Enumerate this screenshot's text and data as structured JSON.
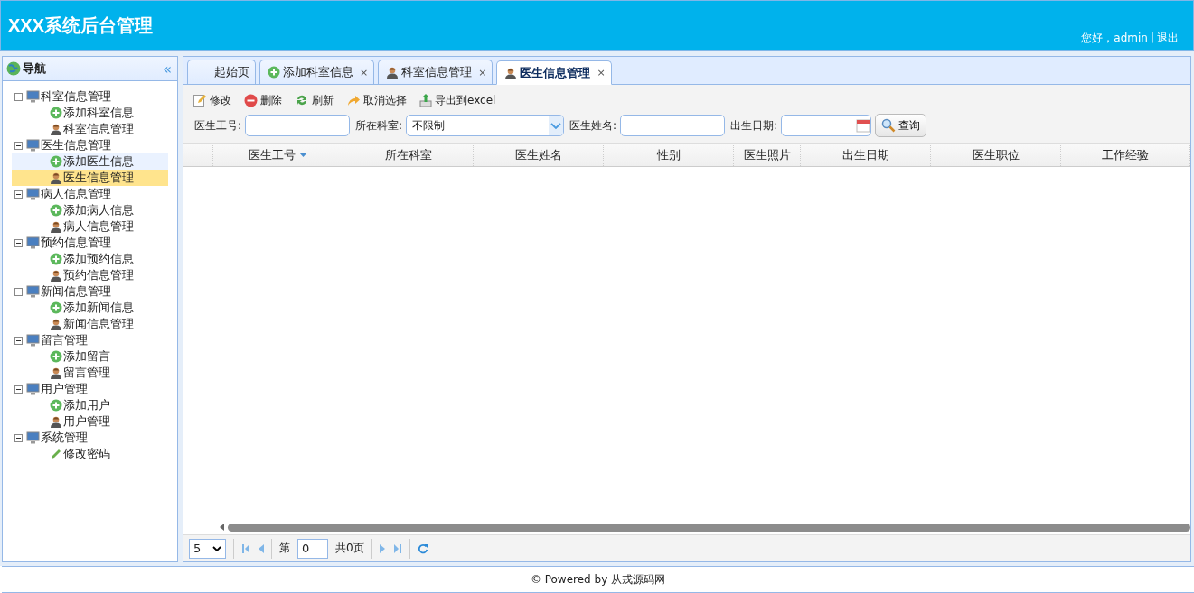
{
  "header": {
    "title": "XXX系统后台管理",
    "greeting": "您好，admin",
    "separator": "|",
    "logout": "退出"
  },
  "nav": {
    "title": "导航",
    "collapse": "«",
    "groups": [
      {
        "label": "科室信息管理",
        "expanded": true,
        "children": [
          {
            "label": "添加科室信息",
            "kind": "add",
            "selected": false,
            "hovered": false
          },
          {
            "label": "科室信息管理",
            "kind": "manage",
            "selected": false,
            "hovered": false
          }
        ]
      },
      {
        "label": "医生信息管理",
        "expanded": true,
        "children": [
          {
            "label": "添加医生信息",
            "kind": "add",
            "selected": false,
            "hovered": true
          },
          {
            "label": "医生信息管理",
            "kind": "manage",
            "selected": true,
            "hovered": false
          }
        ]
      },
      {
        "label": "病人信息管理",
        "expanded": true,
        "children": [
          {
            "label": "添加病人信息",
            "kind": "add",
            "selected": false,
            "hovered": false
          },
          {
            "label": "病人信息管理",
            "kind": "manage",
            "selected": false,
            "hovered": false
          }
        ]
      },
      {
        "label": "预约信息管理",
        "expanded": true,
        "children": [
          {
            "label": "添加预约信息",
            "kind": "add",
            "selected": false,
            "hovered": false
          },
          {
            "label": "预约信息管理",
            "kind": "manage",
            "selected": false,
            "hovered": false
          }
        ]
      },
      {
        "label": "新闻信息管理",
        "expanded": true,
        "children": [
          {
            "label": "添加新闻信息",
            "kind": "add",
            "selected": false,
            "hovered": false
          },
          {
            "label": "新闻信息管理",
            "kind": "manage",
            "selected": false,
            "hovered": false
          }
        ]
      },
      {
        "label": "留言管理",
        "expanded": true,
        "children": [
          {
            "label": "添加留言",
            "kind": "add",
            "selected": false,
            "hovered": false
          },
          {
            "label": "留言管理",
            "kind": "manage",
            "selected": false,
            "hovered": false
          }
        ]
      },
      {
        "label": "用户管理",
        "expanded": true,
        "children": [
          {
            "label": "添加用户",
            "kind": "add",
            "selected": false,
            "hovered": false
          },
          {
            "label": "用户管理",
            "kind": "manage",
            "selected": false,
            "hovered": false
          }
        ]
      },
      {
        "label": "系统管理",
        "expanded": true,
        "children": [
          {
            "label": "修改密码",
            "kind": "edit",
            "selected": false,
            "hovered": false
          }
        ]
      }
    ]
  },
  "tabs": [
    {
      "label": "起始页",
      "kind": "none",
      "closable": false,
      "selected": false
    },
    {
      "label": "添加科室信息",
      "kind": "add",
      "closable": true,
      "selected": false
    },
    {
      "label": "科室信息管理",
      "kind": "manage",
      "closable": true,
      "selected": false
    },
    {
      "label": "医生信息管理",
      "kind": "manage",
      "closable": true,
      "selected": true
    }
  ],
  "close_glyph": "×",
  "toolbar": [
    {
      "label": "修改",
      "kind": "edit"
    },
    {
      "label": "删除",
      "kind": "delete"
    },
    {
      "label": "刷新",
      "kind": "refresh"
    },
    {
      "label": "取消选择",
      "kind": "undo"
    },
    {
      "label": "导出到excel",
      "kind": "export"
    }
  ],
  "search": {
    "fields": [
      {
        "label": "医生工号:",
        "kind": "text"
      },
      {
        "label": "所在科室:",
        "kind": "select",
        "value": "不限制"
      },
      {
        "label": "医生姓名:",
        "kind": "text"
      },
      {
        "label": "出生日期:",
        "kind": "date"
      }
    ],
    "button": "查询"
  },
  "table": {
    "columns": [
      {
        "label": "医生工号",
        "sorted": true
      },
      {
        "label": "所在科室",
        "sorted": false
      },
      {
        "label": "医生姓名",
        "sorted": false
      },
      {
        "label": "性别",
        "sorted": false
      },
      {
        "label": "医生照片",
        "sorted": false
      },
      {
        "label": "出生日期",
        "sorted": false
      },
      {
        "label": "医生职位",
        "sorted": false
      },
      {
        "label": "工作经验",
        "sorted": false
      }
    ]
  },
  "pager": {
    "page_size": "5",
    "page_prefix": "第",
    "page": "0",
    "total": "共0页"
  },
  "footer": "© Powered by 从戎源码网"
}
